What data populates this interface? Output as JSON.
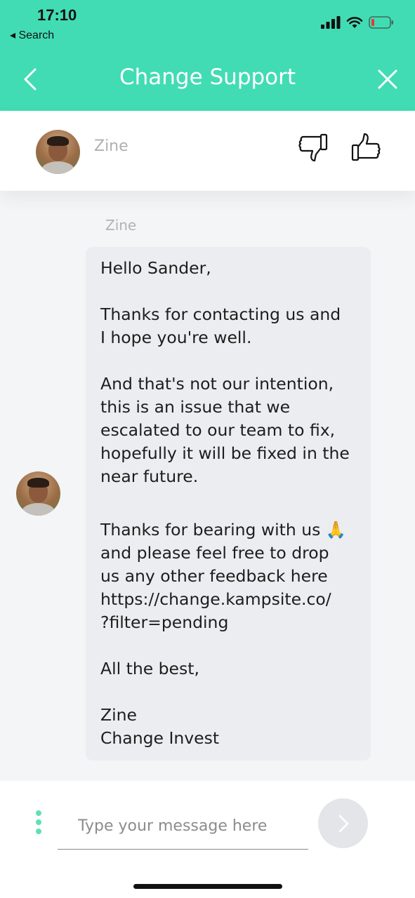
{
  "status_bar": {
    "time": "17:10",
    "back_label": "◂ Search",
    "icons": [
      "signal-icon",
      "wifi-icon",
      "battery-low-icon"
    ],
    "battery_color": "#e53935"
  },
  "header": {
    "title": "Change Support",
    "back_icon": "chevron-left-icon",
    "close_icon": "close-icon",
    "background_color": "#42dcb4"
  },
  "agent": {
    "name": "Zine",
    "rating_icons": [
      "thumbs-down-icon",
      "thumbs-up-icon"
    ]
  },
  "conversation": {
    "sender": "Zine",
    "message": {
      "greeting": "Hello Sander,",
      "para1": "Thanks for contacting us and\nI hope you're well.",
      "para2": "And that's not our intention,\nthis is an issue that we\nescalated to our team to fix,\nhopefully it will be fixed in the\nnear future.",
      "para3": "Thanks for bearing with us 🙏\nand please feel free to drop\nus any other feedback here\nhttps://change.kampsite.co/\n?filter=pending",
      "closing": "All the best,",
      "signature": "Zine\nChange Invest"
    }
  },
  "composer": {
    "placeholder": "Type your message here",
    "value": "",
    "send_icon": "chevron-right-icon",
    "menu_icon": "more-vertical-icon",
    "accent_color": "#5ee0b8"
  }
}
